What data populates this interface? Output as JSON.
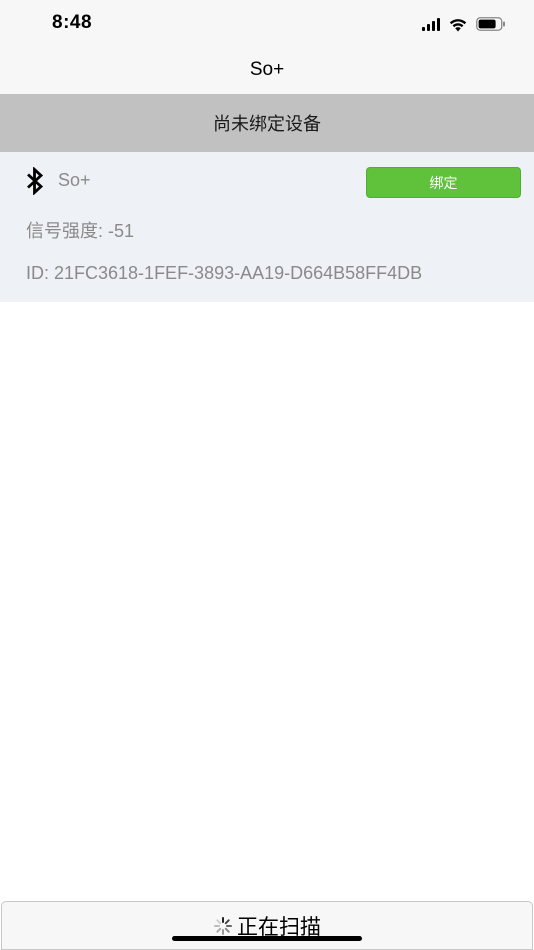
{
  "status_bar": {
    "time": "8:48"
  },
  "nav": {
    "title": "So+"
  },
  "banner": {
    "text": "尚未绑定设备"
  },
  "device": {
    "icon": "bluetooth-icon",
    "name": "So+",
    "bind_label": "绑定",
    "signal_strength": "信号强度: -51",
    "id": "ID: 21FC3618-1FEF-3893-AA19-D664B58FF4DB"
  },
  "scan": {
    "icon": "spinner-icon",
    "label": "正在扫描"
  },
  "colors": {
    "bind_button": "#5fc23a",
    "banner": "#c1c1c1",
    "card": "#eef1f5"
  }
}
